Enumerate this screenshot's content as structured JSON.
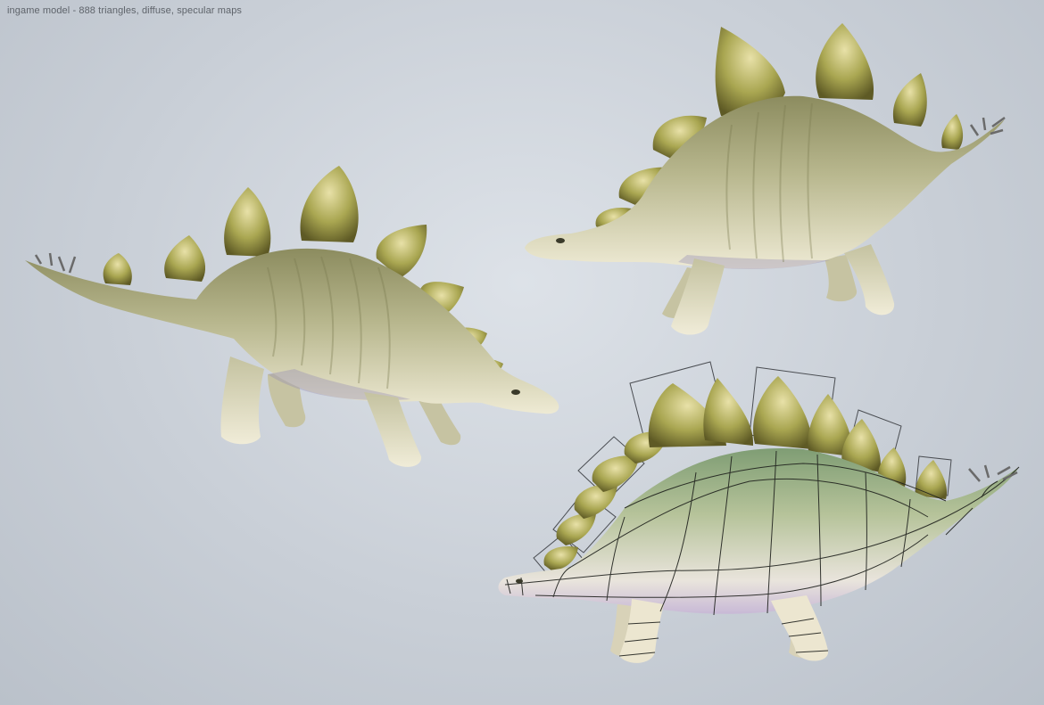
{
  "caption": "ingame model - 888 triangles, diffuse, specular maps",
  "views": [
    {
      "name": "left-side-view",
      "facing": "right",
      "mode": "textured"
    },
    {
      "name": "right-side-view",
      "facing": "left",
      "mode": "textured"
    },
    {
      "name": "wireframe-view",
      "facing": "left",
      "mode": "textured-wireframe"
    }
  ],
  "colors": {
    "background": "#c9cfd7",
    "skin_dark": "#8f8f63",
    "skin_light": "#ece7cf",
    "plate": "#9c9b4a",
    "plate_tip": "#e3dca3",
    "wire": "#1f211d"
  }
}
